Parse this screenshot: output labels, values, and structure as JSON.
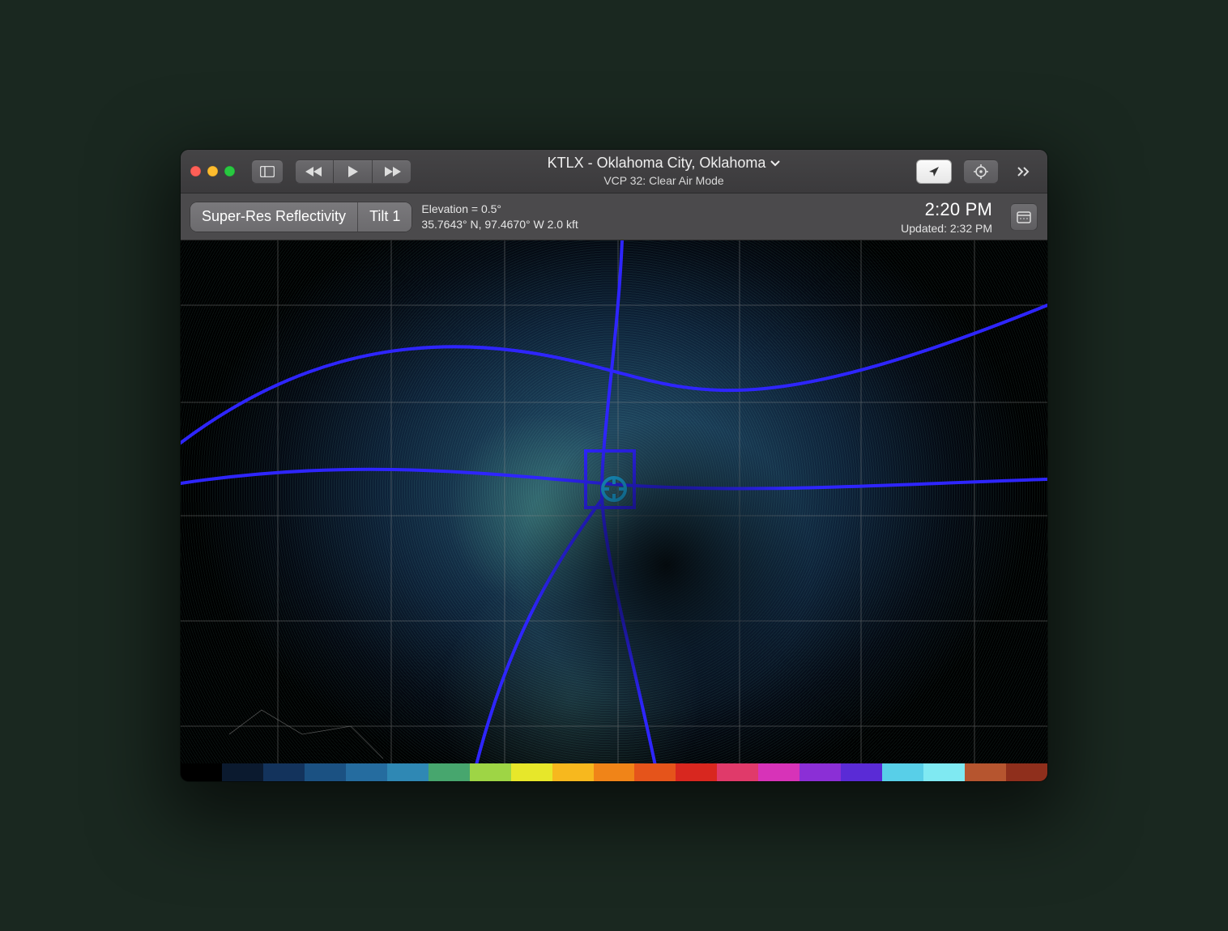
{
  "titlebar": {
    "site_label": "KTLX - Oklahoma City, Oklahoma",
    "mode_label": "VCP 32: Clear Air Mode"
  },
  "infobar": {
    "product_label": "Super-Res Reflectivity",
    "tilt_label": "Tilt 1",
    "elevation_label": "Elevation = 0.5°",
    "coords_label": "35.7643° N, 97.4670° W 2.0 kft",
    "time_label": "2:20 PM",
    "updated_label": "Updated: 2:32 PM"
  },
  "colorscale": [
    "#000000",
    "#0b1a2f",
    "#13335c",
    "#1b5182",
    "#256c9f",
    "#2f88b4",
    "#47a66e",
    "#9ed545",
    "#e7e72a",
    "#f7b81e",
    "#f08418",
    "#e5541b",
    "#d8271f",
    "#e03a6a",
    "#d733b8",
    "#8b2fd6",
    "#5a2bd6",
    "#58cfe8",
    "#7fe9f2",
    "#b6552f",
    "#8f2f1c"
  ]
}
